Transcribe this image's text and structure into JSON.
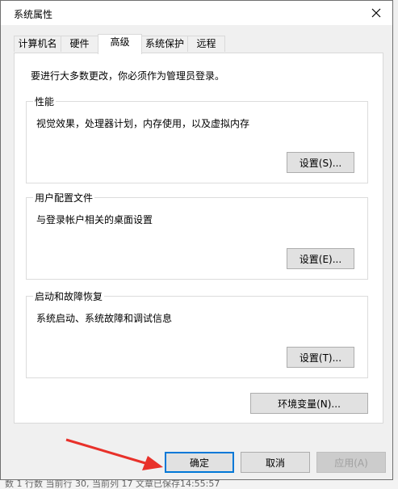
{
  "dialog": {
    "title": "系统属性"
  },
  "tabs": [
    {
      "label": "计算机名"
    },
    {
      "label": "硬件"
    },
    {
      "label": "高级"
    },
    {
      "label": "系统保护"
    },
    {
      "label": "远程"
    }
  ],
  "active_tab": "高级",
  "panel": {
    "admin_note": "要进行大多数更改，你必须作为管理员登录。",
    "groups": [
      {
        "title": "性能",
        "description": "视觉效果，处理器计划，内存使用，以及虚拟内存",
        "button": "设置(S)..."
      },
      {
        "title": "用户配置文件",
        "description": "与登录帐户相关的桌面设置",
        "button": "设置(E)..."
      },
      {
        "title": "启动和故障恢复",
        "description": "系统启动、系统故障和调试信息",
        "button": "设置(T)..."
      }
    ],
    "env_button": "环境变量(N)..."
  },
  "footer": {
    "ok": "确定",
    "cancel": "取消",
    "apply": "应用(A)"
  },
  "background": {
    "status_text": "数  1 行数  当前行 30, 当前列 17  文章已保存14:55:57"
  },
  "colors": {
    "accent": "#0078d7",
    "annotation_arrow": "#e8312a"
  }
}
